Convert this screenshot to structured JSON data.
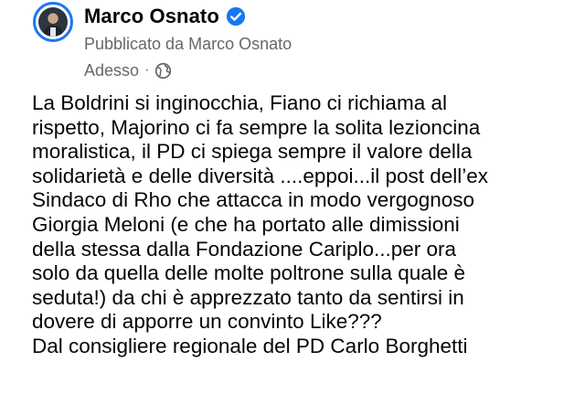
{
  "post": {
    "author_name": "Marco Osnato",
    "published_by": "Pubblicato da Marco Osnato",
    "timestamp": "Adesso",
    "separator": "·",
    "audience_icon": "globe-icon",
    "verified_icon": "verified-badge-icon",
    "accent_color": "#1877f2",
    "text_lines": [
      "La Boldrini si inginocchia, Fiano ci richiama al",
      "rispetto, Majorino ci fa sempre la solita lezioncina",
      "moralistica, il PD ci spiega sempre il valore della",
      "solidarietà e delle diversità ....eppoi...il post dell’ex",
      "Sindaco di Rho che attacca in modo vergognoso",
      "Giorgia Meloni (e che ha portato alle dimissioni",
      "della stessa dalla Fondazione Cariplo...per ora",
      "solo da quella delle molte poltrone sulla quale è",
      "seduta!) da chi è apprezzato tanto da sentirsi in",
      "dovere di apporre un convinto Like???",
      "Dal consigliere regionale del PD Carlo Borghetti"
    ]
  }
}
